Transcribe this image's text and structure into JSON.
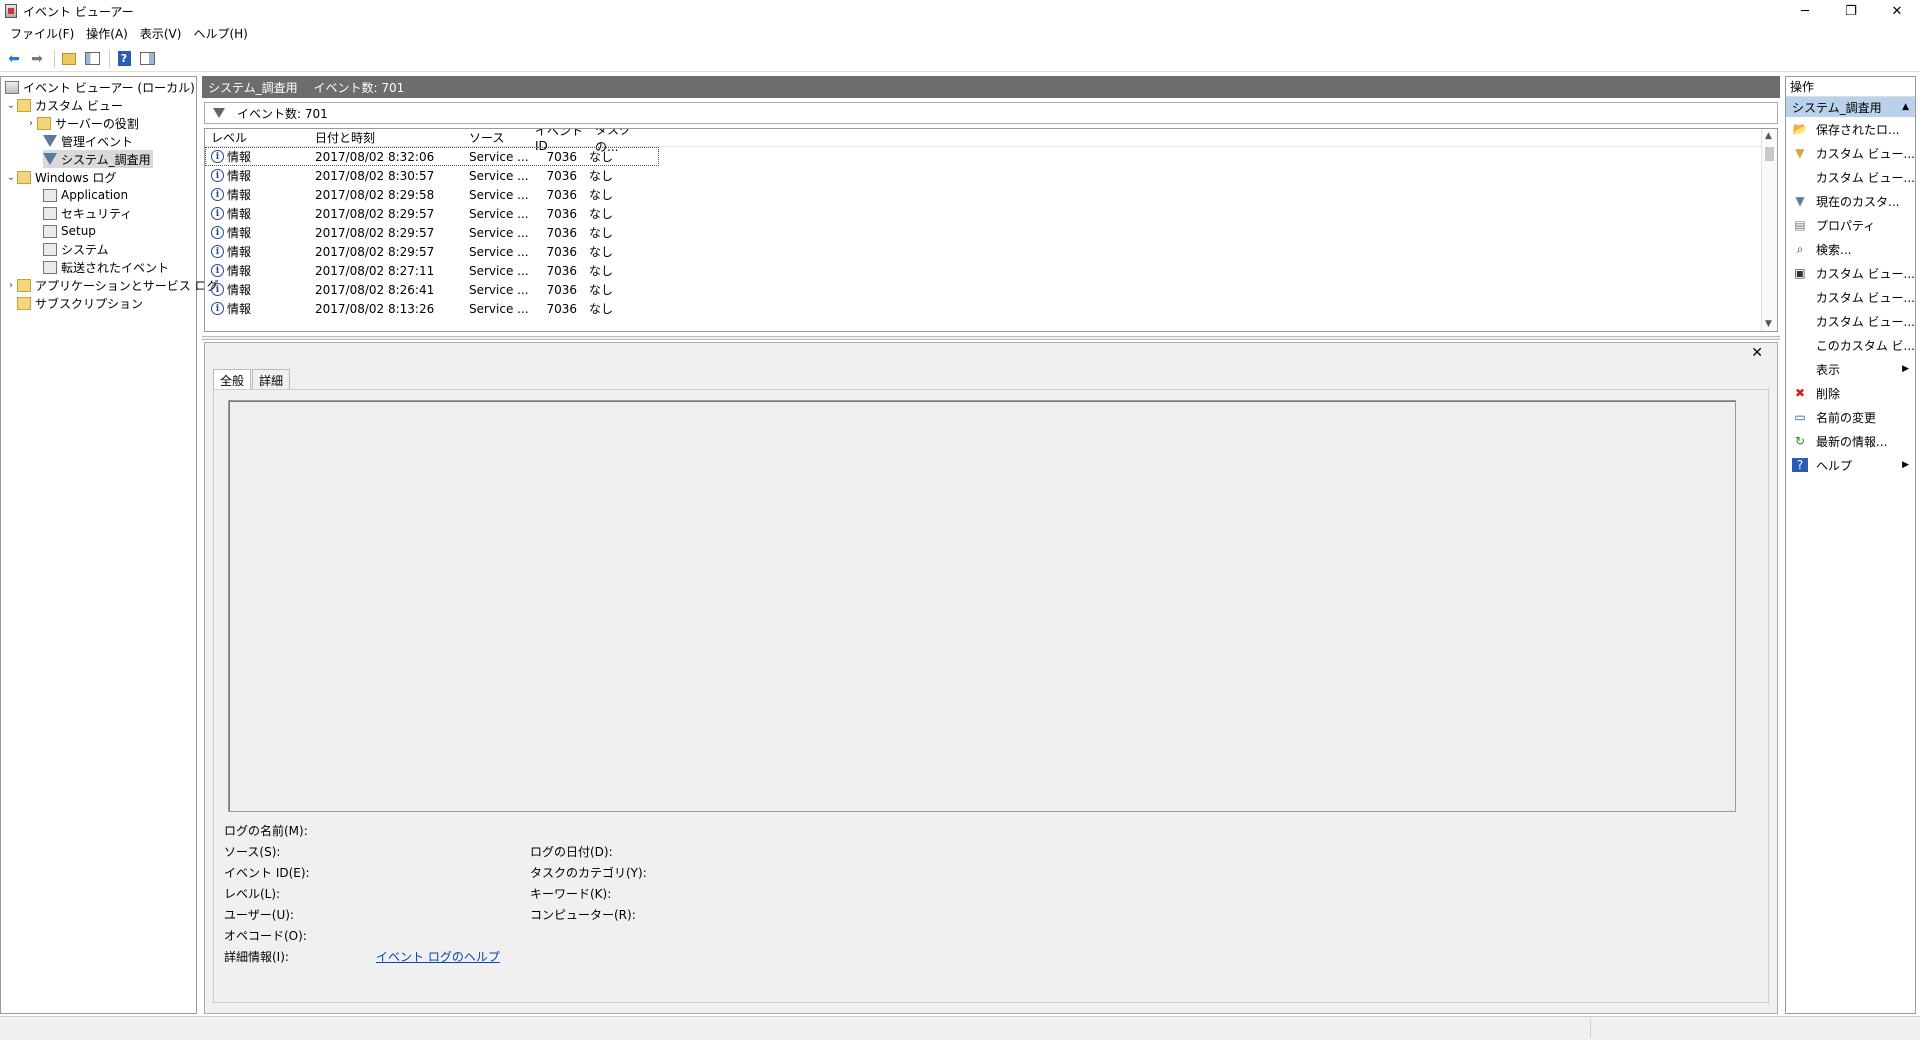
{
  "window": {
    "title": "イベント ビューアー",
    "minimize": "─",
    "restore": "❐",
    "close": "✕"
  },
  "menu": [
    "ファイル(F)",
    "操作(A)",
    "表示(V)",
    "ヘルプ(H)"
  ],
  "toolbar": {
    "icons": [
      "back-arrow-icon",
      "forward-arrow-icon",
      "up-folder-icon",
      "show-hide-tree-icon",
      "help-icon",
      "show-hide-action-pane-icon"
    ]
  },
  "tree": {
    "root": "イベント ビューアー (ローカル)",
    "custom_views": "カスタム ビュー",
    "server_roles": "サーバーの役割",
    "admin_events": "管理イベント",
    "system_survey": "システム_調査用",
    "windows_logs": "Windows ログ",
    "application": "Application",
    "security": "セキュリティ",
    "setup": "Setup",
    "system": "システム",
    "forwarded": "転送されたイベント",
    "app_service_logs": "アプリケーションとサービス ログ",
    "subscriptions": "サブスクリプション"
  },
  "center": {
    "header": "システム_調査用　 イベント数: 701",
    "filter_text": "イベント数: 701",
    "columns": [
      "レベル",
      "日付と時刻",
      "ソース",
      "イベント ID",
      "タスクの..."
    ],
    "rows": [
      {
        "level": "情報",
        "datetime": "2017/08/02 8:32:06",
        "source": "Service ...",
        "id": "7036",
        "task": "なし"
      },
      {
        "level": "情報",
        "datetime": "2017/08/02 8:30:57",
        "source": "Service ...",
        "id": "7036",
        "task": "なし"
      },
      {
        "level": "情報",
        "datetime": "2017/08/02 8:29:58",
        "source": "Service ...",
        "id": "7036",
        "task": "なし"
      },
      {
        "level": "情報",
        "datetime": "2017/08/02 8:29:57",
        "source": "Service ...",
        "id": "7036",
        "task": "なし"
      },
      {
        "level": "情報",
        "datetime": "2017/08/02 8:29:57",
        "source": "Service ...",
        "id": "7036",
        "task": "なし"
      },
      {
        "level": "情報",
        "datetime": "2017/08/02 8:29:57",
        "source": "Service ...",
        "id": "7036",
        "task": "なし"
      },
      {
        "level": "情報",
        "datetime": "2017/08/02 8:27:11",
        "source": "Service ...",
        "id": "7036",
        "task": "なし"
      },
      {
        "level": "情報",
        "datetime": "2017/08/02 8:26:41",
        "source": "Service ...",
        "id": "7036",
        "task": "なし"
      },
      {
        "level": "情報",
        "datetime": "2017/08/02 8:13:26",
        "source": "Service ...",
        "id": "7036",
        "task": "なし"
      }
    ]
  },
  "detail": {
    "close": "✕",
    "tab_general": "全般",
    "tab_details": "詳細",
    "log_name": "ログの名前(M):",
    "source": "ソース(S):",
    "event_id": "イベント ID(E):",
    "level": "レベル(L):",
    "user": "ユーザー(U):",
    "opcode": "オペコード(O):",
    "more_info": "詳細情報(I):",
    "logged": "ログの日付(D):",
    "task_category": "タスクのカテゴリ(Y):",
    "keywords": "キーワード(K):",
    "computer": "コンピューター(R):",
    "help_link": "イベント ログのヘルプ"
  },
  "actions": {
    "header": "操作",
    "section": "システム_調査用",
    "items": [
      {
        "label": "保存されたロ...",
        "icon": "open-folder-icon",
        "glyph": "📂",
        "color": "#d8a23a"
      },
      {
        "label": "カスタム ビュー...",
        "icon": "filter-icon",
        "glyph": "▼",
        "color": "#d6a43b"
      },
      {
        "label": "カスタム ビュー...",
        "icon": "",
        "glyph": "",
        "color": "#000"
      },
      {
        "label": "現在のカスタ...",
        "icon": "filter-icon",
        "glyph": "▼",
        "color": "#5a7aa0"
      },
      {
        "label": "プロパティ",
        "icon": "properties-icon",
        "glyph": "▤",
        "color": "#777"
      },
      {
        "label": "検索...",
        "icon": "binoculars-icon",
        "glyph": "⌕",
        "color": "#333"
      },
      {
        "label": "カスタム ビュー...",
        "icon": "save-icon",
        "glyph": "▣",
        "color": "#333"
      },
      {
        "label": "カスタム ビュー...",
        "icon": "",
        "glyph": "",
        "color": "#000"
      },
      {
        "label": "カスタム ビュー...",
        "icon": "",
        "glyph": "",
        "color": "#000"
      },
      {
        "label": "このカスタム ビ...",
        "icon": "",
        "glyph": "",
        "color": "#000"
      },
      {
        "label": "表示",
        "icon": "",
        "glyph": "",
        "color": "#000",
        "submenu": true
      },
      {
        "label": "削除",
        "icon": "delete-icon",
        "glyph": "✖",
        "color": "#d02020"
      },
      {
        "label": "名前の変更",
        "icon": "rename-icon",
        "glyph": "▭",
        "color": "#1e5aa8"
      },
      {
        "label": "最新の情報...",
        "icon": "refresh-icon",
        "glyph": "↻",
        "color": "#2a8a2a"
      },
      {
        "label": "ヘルプ",
        "icon": "help-icon",
        "glyph": "?",
        "color": "#fff",
        "bg": "#2b5cb5",
        "submenu": true
      }
    ]
  }
}
